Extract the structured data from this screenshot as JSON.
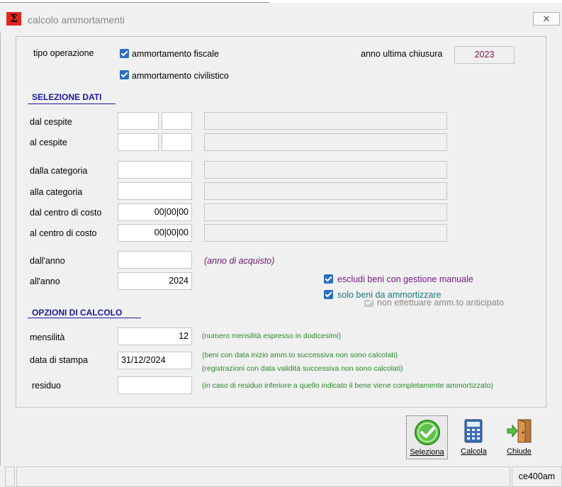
{
  "window": {
    "title": "calcolo ammortamenti"
  },
  "top": {
    "tipo_operazione_label": "tipo operazione",
    "check_fiscale_label": "ammortamento fiscale",
    "check_civilistico_label": "ammortamento civilistico",
    "anno_chiusura_label": "anno ultima chiusura",
    "anno_chiusura_value": "2023"
  },
  "selezione": {
    "header": "SELEZIONE DATI",
    "dal_cespite_label": "dal cespite",
    "al_cespite_label": "al cespite",
    "dalla_categoria_label": "dalla categoria",
    "alla_categoria_label": "alla categoria",
    "dal_centro_label": "dal centro di costo",
    "dal_centro_value": "00|00|00",
    "al_centro_label": "al centro di costo",
    "al_centro_value": "00|00|00",
    "dall_anno_label": "dall'anno",
    "dall_anno_hint": "(anno di acquisto)",
    "all_anno_label": "all'anno",
    "all_anno_value": "2024",
    "check_escludi_label": "escludi beni con gestione manuale",
    "check_solo_label": "solo beni da ammortizzare",
    "check_anticipato_label": "non effettuare amm.to anticipato"
  },
  "opzioni": {
    "header": "OPZIONI DI CALCOLO",
    "mensilita_label": "mensilità",
    "mensilita_value": "12",
    "mensilita_hint": "(numero mensilità espresso in dodicesimi)",
    "data_stampa_label": "data di stampa",
    "data_stampa_value": "31/12/2024",
    "data_stampa_hint1": "(beni con data inizio amm.to successiva non sono calcolati)",
    "data_stampa_hint2": "(registrazioni con data validità successiva non sono calcolati)",
    "residuo_label": "residuo",
    "residuo_hint": "(in caso di residuo inferiore a quello indicato il bene viene completamente ammortizzato)"
  },
  "buttons": {
    "seleziona": "Seleziona",
    "calcola": "Calcola",
    "chiude": "Chiude"
  },
  "status": {
    "code": "ce400am"
  },
  "colors": {
    "checkbox": "#2c6ec0",
    "section": "#1a1aa0",
    "hint_green": "#2a8a2a",
    "escludi_text": "#7a1a8a",
    "solo_text": "#1a7a7a",
    "year_value": "#7a1a4a"
  }
}
